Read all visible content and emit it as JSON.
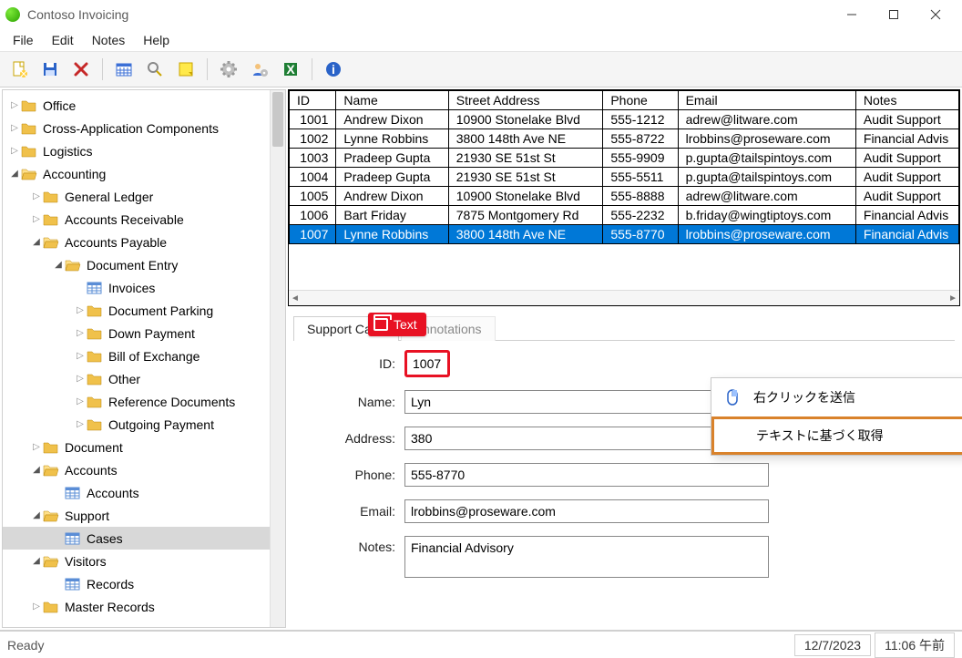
{
  "window": {
    "title": "Contoso Invoicing"
  },
  "menu": {
    "file": "File",
    "edit": "Edit",
    "notes": "Notes",
    "help": "Help"
  },
  "tree": [
    {
      "label": "Office",
      "depth": 0,
      "expanded": false,
      "icon": "folder"
    },
    {
      "label": "Cross-Application Components",
      "depth": 0,
      "expanded": false,
      "icon": "folder"
    },
    {
      "label": "Logistics",
      "depth": 0,
      "expanded": false,
      "icon": "folder"
    },
    {
      "label": "Accounting",
      "depth": 0,
      "expanded": true,
      "icon": "folder-open"
    },
    {
      "label": "General Ledger",
      "depth": 1,
      "expanded": false,
      "icon": "folder"
    },
    {
      "label": "Accounts Receivable",
      "depth": 1,
      "expanded": false,
      "icon": "folder"
    },
    {
      "label": "Accounts Payable",
      "depth": 1,
      "expanded": true,
      "icon": "folder-open"
    },
    {
      "label": "Document Entry",
      "depth": 2,
      "expanded": true,
      "icon": "folder-open"
    },
    {
      "label": "Invoices",
      "depth": 3,
      "expanded": null,
      "icon": "grid"
    },
    {
      "label": "Document Parking",
      "depth": 3,
      "expanded": false,
      "icon": "folder"
    },
    {
      "label": "Down Payment",
      "depth": 3,
      "expanded": false,
      "icon": "folder"
    },
    {
      "label": "Bill of Exchange",
      "depth": 3,
      "expanded": false,
      "icon": "folder"
    },
    {
      "label": "Other",
      "depth": 3,
      "expanded": false,
      "icon": "folder"
    },
    {
      "label": "Reference Documents",
      "depth": 3,
      "expanded": false,
      "icon": "folder"
    },
    {
      "label": "Outgoing Payment",
      "depth": 3,
      "expanded": false,
      "icon": "folder"
    },
    {
      "label": "Document",
      "depth": 1,
      "expanded": false,
      "icon": "folder"
    },
    {
      "label": "Accounts",
      "depth": 1,
      "expanded": true,
      "icon": "folder-open"
    },
    {
      "label": "Accounts",
      "depth": 2,
      "expanded": null,
      "icon": "grid"
    },
    {
      "label": "Support",
      "depth": 1,
      "expanded": true,
      "icon": "folder-open"
    },
    {
      "label": "Cases",
      "depth": 2,
      "expanded": null,
      "icon": "grid",
      "selected": true
    },
    {
      "label": "Visitors",
      "depth": 1,
      "expanded": true,
      "icon": "folder-open"
    },
    {
      "label": "Records",
      "depth": 2,
      "expanded": null,
      "icon": "grid"
    },
    {
      "label": "Master Records",
      "depth": 1,
      "expanded": false,
      "icon": "folder"
    }
  ],
  "grid": {
    "headers": [
      "ID",
      "Name",
      "Street Address",
      "Phone",
      "Email",
      "Notes"
    ],
    "rows": [
      [
        "1001",
        "Andrew Dixon",
        "10900 Stonelake Blvd",
        "555-1212",
        "adrew@litware.com",
        "Audit Support"
      ],
      [
        "1002",
        "Lynne Robbins",
        "3800 148th Ave NE",
        "555-8722",
        "lrobbins@proseware.com",
        "Financial Advis"
      ],
      [
        "1003",
        "Pradeep Gupta",
        "21930 SE 51st St",
        "555-9909",
        "p.gupta@tailspintoys.com",
        "Audit Support"
      ],
      [
        "1004",
        "Pradeep Gupta",
        "21930 SE 51st St",
        "555-5511",
        "p.gupta@tailspintoys.com",
        "Audit Support"
      ],
      [
        "1005",
        "Andrew Dixon",
        "10900 Stonelake Blvd",
        "555-8888",
        "adrew@litware.com",
        "Audit Support"
      ],
      [
        "1006",
        "Bart Friday",
        "7875 Montgomery Rd",
        "555-2232",
        "b.friday@wingtiptoys.com",
        "Financial Advis"
      ],
      [
        "1007",
        "Lynne Robbins",
        "3800 148th Ave NE",
        "555-8770",
        "lrobbins@proseware.com",
        "Financial Advis"
      ]
    ],
    "selected": 6
  },
  "tabs": {
    "t0": "Support Case",
    "t1": "Annotations",
    "tag": "Text"
  },
  "form": {
    "labels": {
      "id": "ID:",
      "name": "Name:",
      "address": "Address:",
      "phone": "Phone:",
      "email": "Email:",
      "notes": "Notes:"
    },
    "values": {
      "id": "1007",
      "name": "Lyn",
      "address": "380",
      "phone": "555-8770",
      "email": "lrobbins@proseware.com",
      "notes": "Financial Advisory"
    }
  },
  "context_menu": {
    "send_right_click": "右クリックを送信",
    "get_by_text": "テキストに基づく取得"
  },
  "status": {
    "ready": "Ready",
    "date": "12/7/2023",
    "time": "11:06 午前"
  }
}
